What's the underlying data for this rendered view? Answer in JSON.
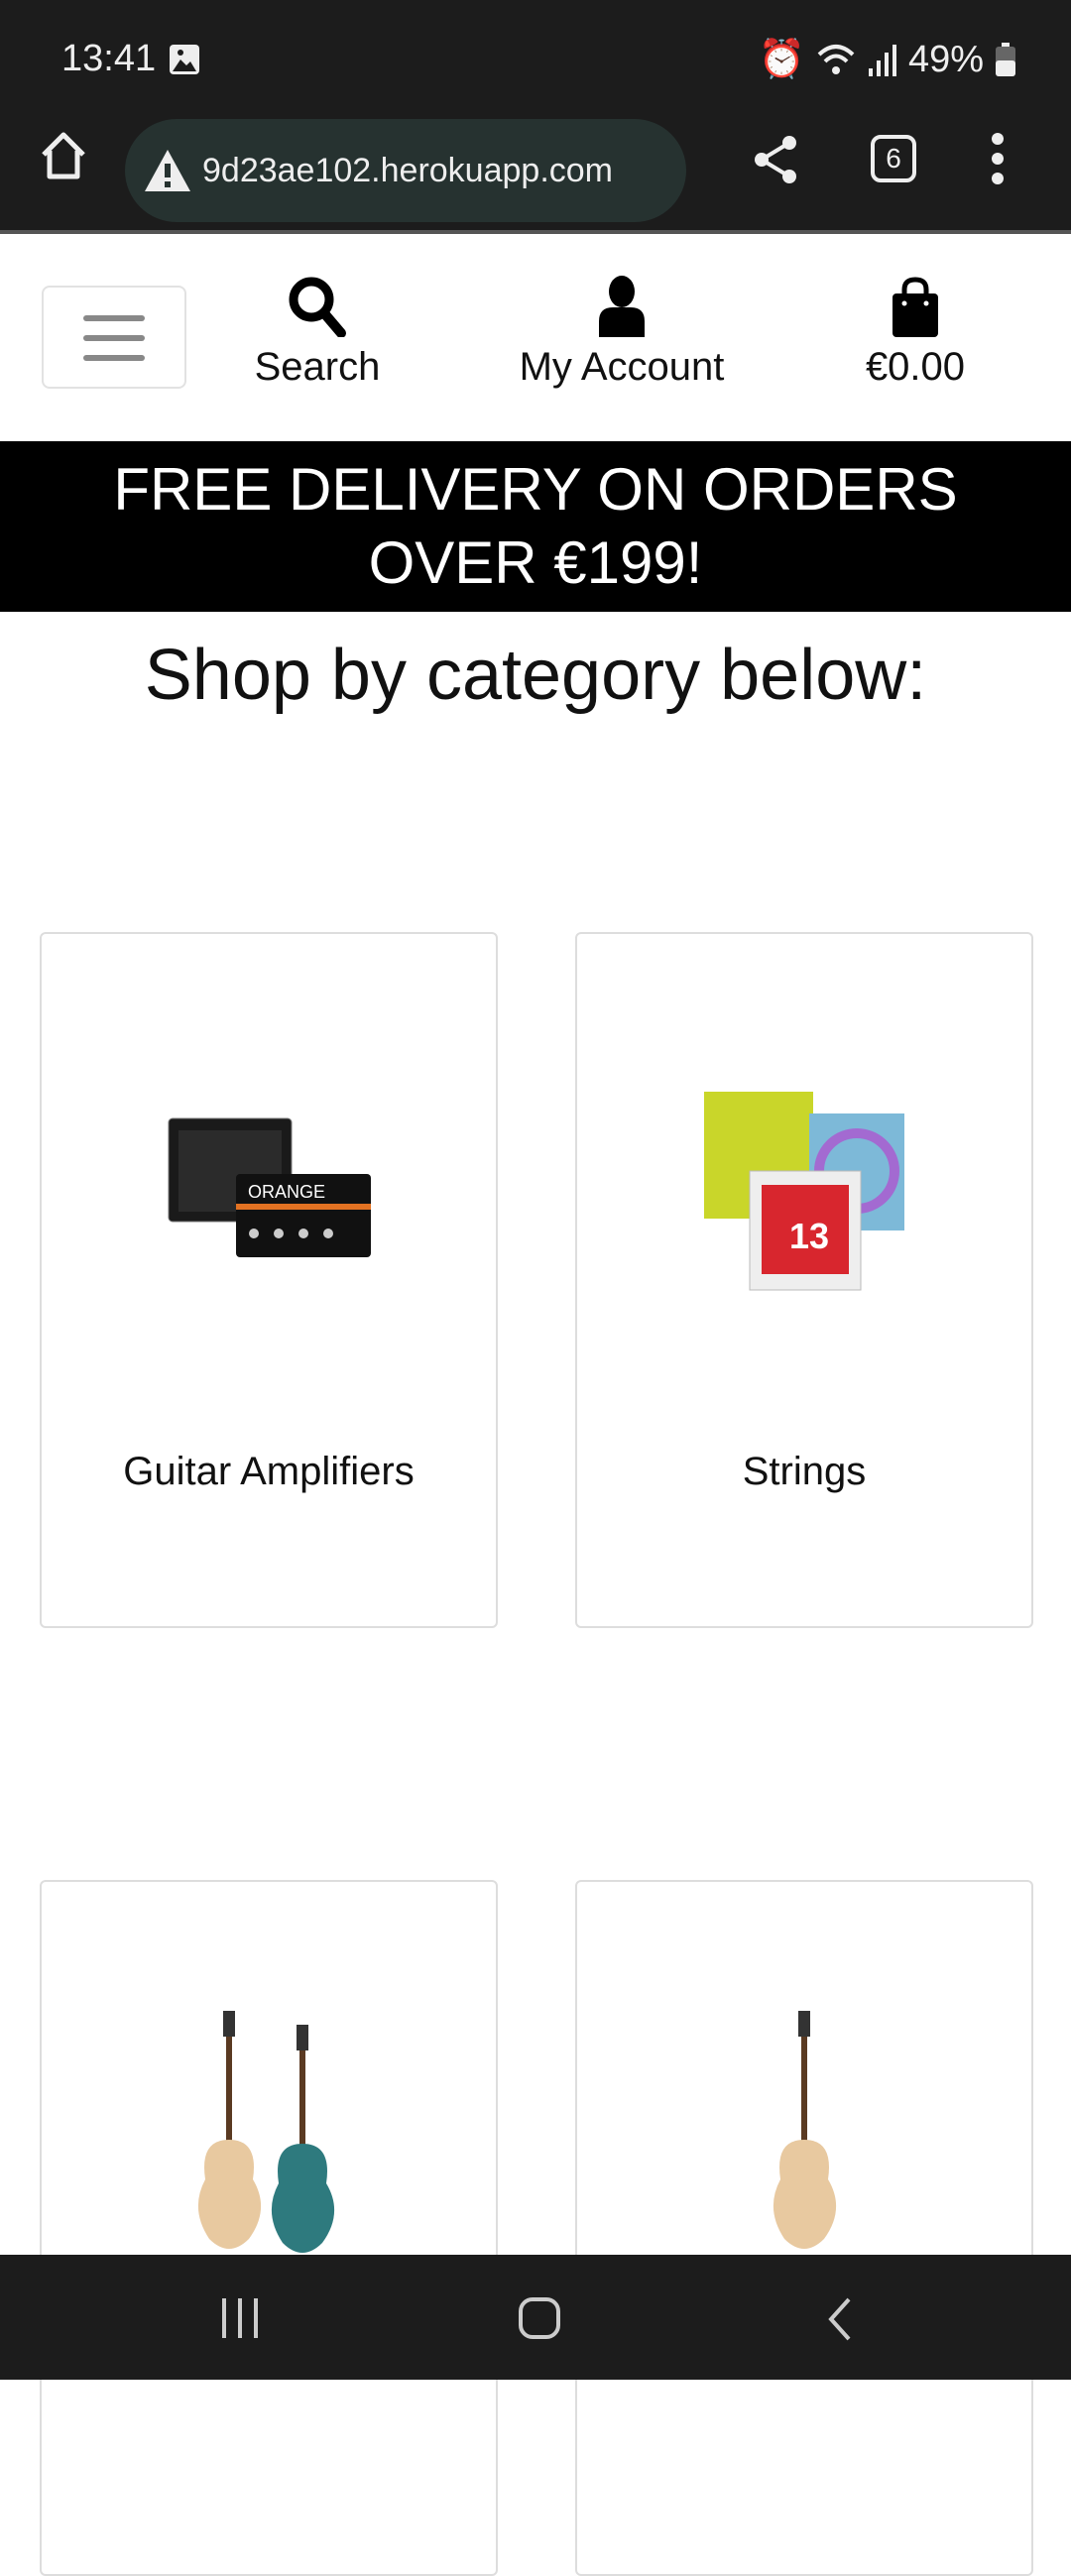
{
  "status_bar": {
    "time": "13:41",
    "battery": "49%",
    "icons": [
      "gallery-icon",
      "alarm-icon",
      "wifi-icon",
      "signal-icon",
      "battery-icon"
    ]
  },
  "browser": {
    "url": "​9d23ae102.herokuapp.com",
    "tab_count": "6",
    "icons": [
      "home-icon",
      "warning-icon",
      "share-icon",
      "tabs-icon",
      "more-icon"
    ]
  },
  "header": {
    "search_label": "Search",
    "account_label": "My Account",
    "bag_total": "€0.00"
  },
  "banner": {
    "line1": "FREE DELIVERY ON ORDERS",
    "line2": "OVER €199!"
  },
  "page": {
    "heading": "Shop by category below:"
  },
  "categories": [
    {
      "label": "Guitar Amplifiers"
    },
    {
      "label": "Strings"
    },
    {
      "label": ""
    },
    {
      "label": ""
    }
  ]
}
